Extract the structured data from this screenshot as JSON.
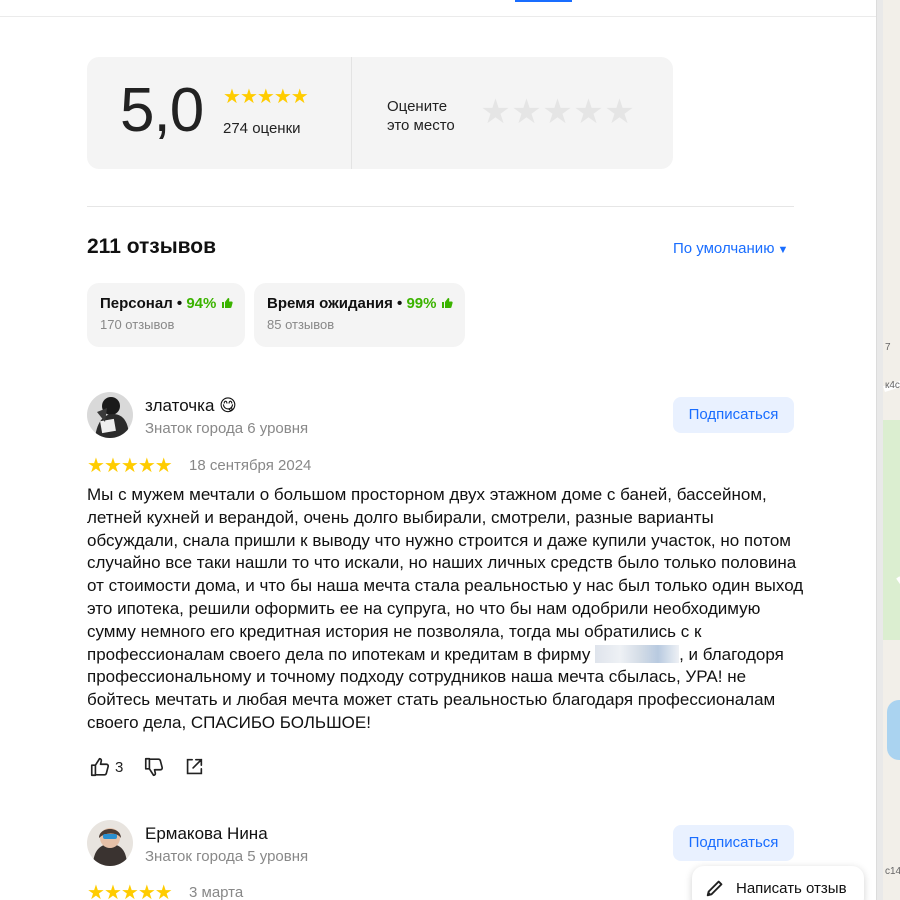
{
  "rating": {
    "score": "5,0",
    "stars_value": 5,
    "count_label": "274 оценки",
    "rate_prompt_line1": "Оцените",
    "rate_prompt_line2": "это место"
  },
  "reviews_header": {
    "title": "211 отзывов",
    "sort_label": "По умолчанию"
  },
  "aspects": [
    {
      "name": "Персонал",
      "percent": "94%",
      "count": "170 отзывов"
    },
    {
      "name": "Время ожидания",
      "percent": "99%",
      "count": "85 отзывов"
    }
  ],
  "reviews": [
    {
      "author": "златочка",
      "emoji": "😋",
      "level": "Знаток города 6 уровня",
      "subscribe_label": "Подписаться",
      "rating": 5,
      "date": "18 сентября 2024",
      "text_before_redaction": "Мы с мужем мечтали о большом просторном двух этажном доме с баней, бассейном, летней кухней и верандой, очень долго выбирали, смотрели, разные варианты обсуждали, снала пришли к выводу что нужно строится и даже купили участок, но потом случайно все таки нашли то что искали, но наших личных средств было только половина от стоимости дома, и что бы наша мечта стала реальностью у нас был только один выход это ипотека, решили оформить ее на супруга, но что бы нам одобрили необходимую сумму немного его кредитная история не позволяла, тогда мы обратились с к профессионалам своего дела по ипотекам и кредитам в фирму ",
      "text_after_redaction": ", и благодоря профессиональному и точному подходу сотрудников наша мечта сбылась, УРА! не бойтесь мечтать и любая мечта может стать реальностью благодаря профессионалам своего дела, СПАСИБО БОЛЬШОЕ!",
      "likes": "3"
    },
    {
      "author": "Ермакова Нина",
      "level": "Знаток города 5 уровня",
      "subscribe_label": "Подписаться",
      "rating": 5,
      "date": "3 марта"
    }
  ],
  "fab": {
    "label": "Написать отзыв"
  },
  "icons": {
    "star": "star-icon",
    "like": "thumb-up-icon",
    "dislike": "thumb-down-icon",
    "share": "share-icon",
    "pen": "pen-icon"
  },
  "colors": {
    "accent": "#196dff",
    "star": "#ffcc00",
    "positive": "#3bb300",
    "card_bg": "#f4f4f4",
    "subscribe_bg": "#e9f1ff"
  },
  "map_labels": [
    "7",
    "к4с",
    "с14"
  ]
}
